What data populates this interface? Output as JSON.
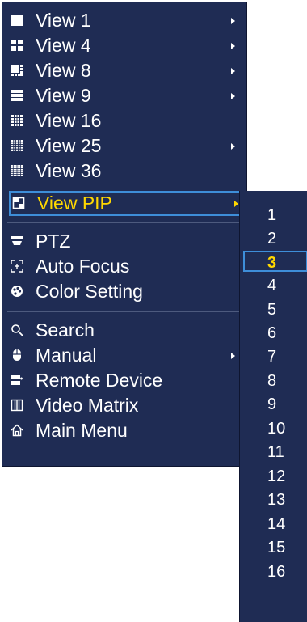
{
  "menu": {
    "items": [
      {
        "label": "View 1",
        "icon": "single-view-icon",
        "submenu": true
      },
      {
        "label": "View 4",
        "icon": "quad-view-icon",
        "submenu": true
      },
      {
        "label": "View 8",
        "icon": "eight-view-icon",
        "submenu": true
      },
      {
        "label": "View 9",
        "icon": "nine-view-icon",
        "submenu": true
      },
      {
        "label": "View 16",
        "icon": "sixteen-view-icon",
        "submenu": false
      },
      {
        "label": "View 25",
        "icon": "twentyfive-view-icon",
        "submenu": true
      },
      {
        "label": "View 36",
        "icon": "thirtysix-view-icon",
        "submenu": false
      },
      {
        "label": "View PIP",
        "icon": "pip-view-icon",
        "submenu": true
      },
      {
        "label": "PTZ",
        "icon": "ptz-camera-icon",
        "submenu": false
      },
      {
        "label": "Auto Focus",
        "icon": "auto-focus-icon",
        "submenu": false
      },
      {
        "label": "Color Setting",
        "icon": "palette-icon",
        "submenu": false
      },
      {
        "label": "Search",
        "icon": "search-icon",
        "submenu": false
      },
      {
        "label": "Manual",
        "icon": "mouse-icon",
        "submenu": true
      },
      {
        "label": "Remote Device",
        "icon": "remote-device-icon",
        "submenu": false
      },
      {
        "label": "Video Matrix",
        "icon": "video-matrix-icon",
        "submenu": false
      },
      {
        "label": "Main Menu",
        "icon": "home-icon",
        "submenu": false
      }
    ],
    "selected_label": "View PIP"
  },
  "pip_submenu": {
    "options": [
      "1",
      "2",
      "3",
      "4",
      "5",
      "6",
      "7",
      "8",
      "9",
      "10",
      "11",
      "12",
      "13",
      "14",
      "15",
      "16"
    ],
    "selected": "3"
  },
  "colors": {
    "menu_bg": "#1f2c54",
    "highlight_border": "#3e8ed9",
    "selected_text": "#ffd800",
    "text": "#ffffff"
  }
}
